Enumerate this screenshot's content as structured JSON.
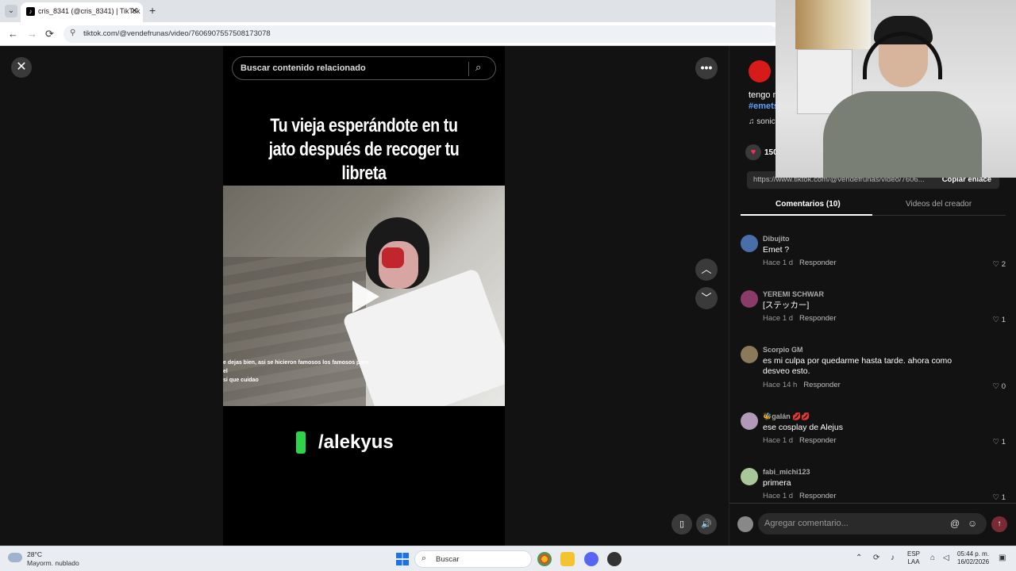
{
  "browser": {
    "tab_title": "cris_8341 (@cris_8341) | TikTok",
    "tab_close": "✕",
    "new_tab": "+",
    "url": "tiktok.com/@vendefrunas/video/7606907557508173078",
    "back": "←",
    "forward": "→",
    "reload": "⟳"
  },
  "viewer": {
    "close_label": "✕",
    "search_placeholder": "Buscar contenido relacionado",
    "caption_line1": "Tu vieja esperándote en tu",
    "caption_line2": "jato después de recoger tu libreta",
    "clip_subtitle_1": "e dejas bien, asi se hicieron famosos los famosos pero el",
    "clip_subtitle_2": "si que cuidao",
    "credit": "/alekyus",
    "more_label": "•••",
    "up_label": "︿",
    "down_label": "﹀"
  },
  "panel": {
    "desc": "tengo m",
    "tags": "#emets",
    "music": "♫  sonic",
    "likes": "150",
    "share_url": "https://www.tiktok.com/@vendefrunas/video/7606...",
    "copy_link": "Copiar enlace",
    "tab_comments": "Comentarios (10)",
    "tab_creator": "Videos del creador",
    "reply_label": "Responder",
    "comments": [
      {
        "user": "Dibujito",
        "text": "Emet ?",
        "time": "Hace 1 d",
        "likes": "2",
        "color": "#4a6fa8"
      },
      {
        "user": "YEREMI SCHWAR",
        "text": "[ステッカー]",
        "time": "Hace 1 d",
        "likes": "1",
        "color": "#8a3b6a"
      },
      {
        "user": "Scorpio GM",
        "text": "es mi culpa por quedarme hasta tarde. ahora como desveo esto.",
        "time": "Hace 14 h",
        "likes": "0",
        "color": "#8a7a5a"
      },
      {
        "user": "🐝galán 💋💋",
        "text": "ese cosplay de Alejus",
        "time": "Hace 1 d",
        "likes": "1",
        "color": "#b09ab8"
      },
      {
        "user": "fabi_michi123",
        "text": "primera",
        "time": "Hace 1 d",
        "likes": "1",
        "color": "#a8c89a"
      }
    ],
    "add_comment_placeholder": "Agregar comentario...",
    "at_symbol": "@",
    "emoji_symbol": "☺",
    "send_symbol": "↑"
  },
  "taskbar": {
    "temp": "28°C",
    "weather": "Mayorm. nublado",
    "search": "Buscar",
    "lang_1": "ESP",
    "lang_2": "LAA",
    "time": "05:44 p. m.",
    "date": "16/02/2026"
  }
}
